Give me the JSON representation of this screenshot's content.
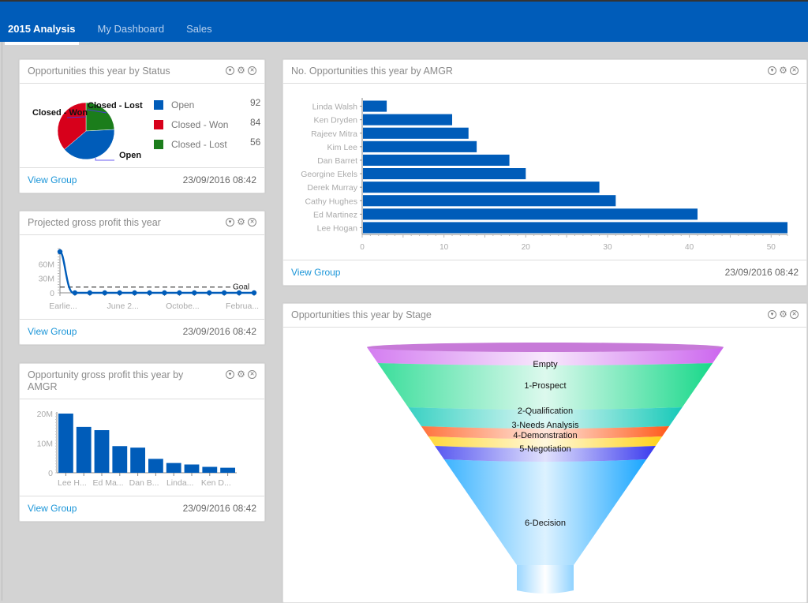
{
  "tabs": [
    {
      "label": "2015 Analysis",
      "active": true
    },
    {
      "label": "My Dashboard",
      "active": false
    },
    {
      "label": "Sales",
      "active": false
    }
  ],
  "common": {
    "view_group": "View Group",
    "timestamp": "23/09/2016 08:42",
    "icons": [
      "dropdown-icon",
      "gear-icon",
      "close-icon"
    ]
  },
  "cards": {
    "status": {
      "title": "Opportunities this year by Status",
      "chart_data": {
        "type": "pie",
        "title": "Opportunities this year by Status",
        "labels": [
          "Open",
          "Closed - Won",
          "Closed - Lost"
        ],
        "values": [
          92,
          84,
          56
        ],
        "colors": [
          "#005cb9",
          "#d7001b",
          "#1b7d1b"
        ],
        "legend": "right"
      }
    },
    "profit": {
      "title": "Projected gross profit this year",
      "chart_data": {
        "type": "line",
        "title": "Projected gross profit this year",
        "x_tick_labels": [
          "Earlie...",
          "June 2...",
          "Octobe...",
          "Februa..."
        ],
        "y_tick_labels": [
          "0",
          "30M",
          "60M"
        ],
        "values": [
          85000000,
          0,
          0,
          0,
          0,
          0,
          0,
          0,
          0,
          0,
          0,
          0,
          0,
          0
        ],
        "goal": 12000000,
        "goal_label": "Goal",
        "ylim": [
          0,
          85000000
        ],
        "color": "#005cb9"
      }
    },
    "gpamgr": {
      "title": "Opportunity gross profit this year by AMGR",
      "chart_data": {
        "type": "bar",
        "title": "Opportunity gross profit this year by AMGR",
        "categories": [
          "Lee H...",
          "",
          "Ed Ma...",
          "",
          "Dan B...",
          "",
          "Linda...",
          "",
          "Ken D...",
          ""
        ],
        "values": [
          20000000,
          15500000,
          14400000,
          9000000,
          8500000,
          4700000,
          3300000,
          2800000,
          2000000,
          1700000
        ],
        "y_tick_labels": [
          "0",
          "10M",
          "20M"
        ],
        "ylim": [
          0,
          20000000
        ],
        "color": "#005cb9"
      }
    },
    "noamgr": {
      "title": "No. Opportunities this year by AMGR",
      "chart_data": {
        "type": "bar",
        "orientation": "horizontal",
        "title": "No. Opportunities this year by AMGR",
        "categories": [
          "Linda Walsh",
          "Ken Dryden",
          "Rajeev Mitra",
          "Kim Lee",
          "Dan Barret",
          "Georgine Ekels",
          "Derek Murray",
          "Cathy Hughes",
          "Ed Martinez",
          "Lee Hogan"
        ],
        "values": [
          3,
          11,
          13,
          14,
          18,
          20,
          29,
          31,
          41,
          52
        ],
        "x_ticks": [
          0,
          10,
          20,
          30,
          40,
          50
        ],
        "xlim": [
          0,
          52
        ],
        "color": "#005cb9"
      }
    },
    "stage": {
      "title": "Opportunities this year by Stage",
      "chart_data": {
        "type": "funnel",
        "title": "Opportunities this year by Stage",
        "stages": [
          {
            "label": "Empty",
            "color": "#cc66ee"
          },
          {
            "label": "1-Prospect",
            "color": "#19d88a"
          },
          {
            "label": "2-Qualification",
            "color": "#17c9b8"
          },
          {
            "label": "3-Needs Analysis",
            "color": "#ff5a1a"
          },
          {
            "label": "4-Demonstration",
            "color": "#ffd21a"
          },
          {
            "label": "5-Negotiation",
            "color": "#3a3aee"
          },
          {
            "label": "6-Decision",
            "color": "#1aa6ff"
          }
        ]
      }
    }
  }
}
